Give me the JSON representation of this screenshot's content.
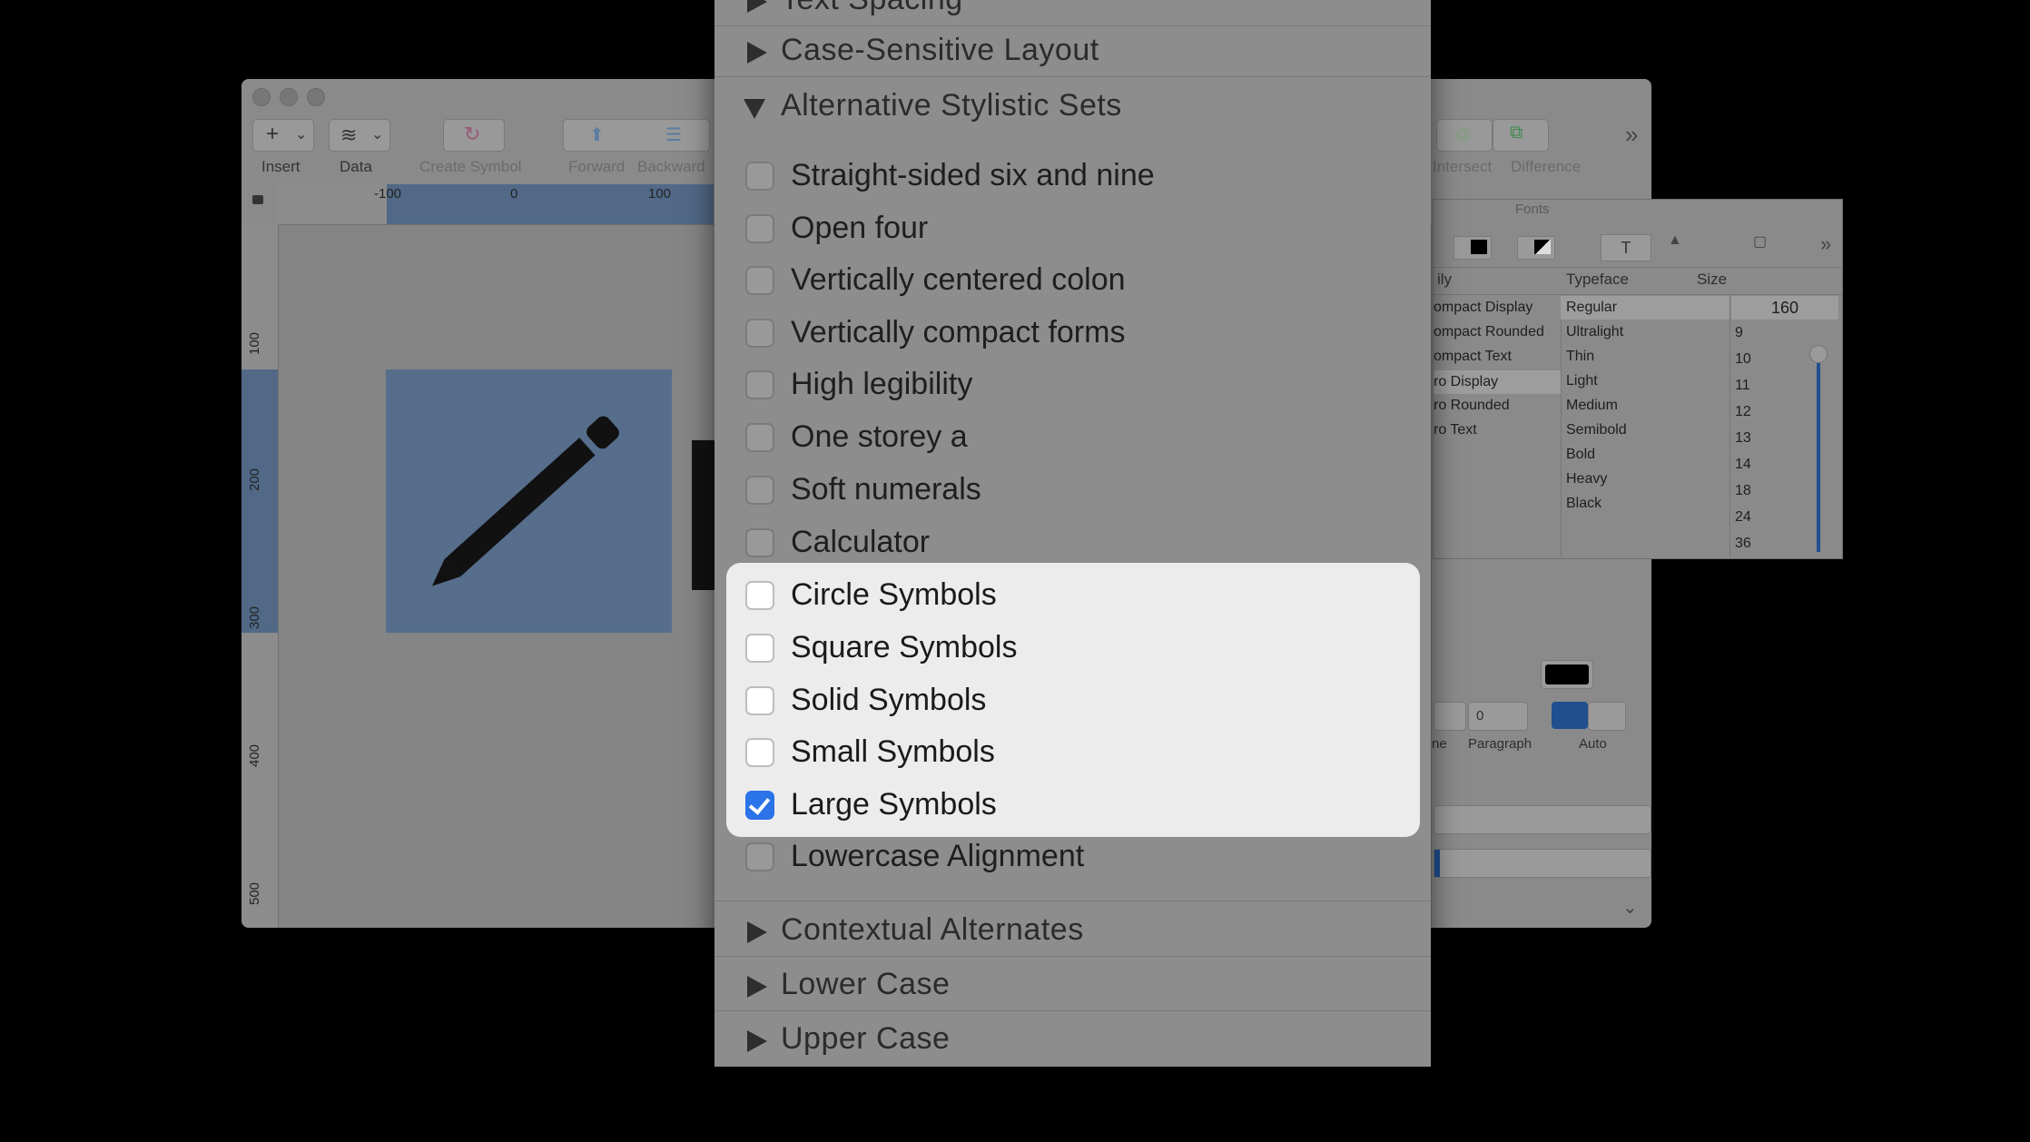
{
  "toolbar": {
    "insert": "Insert",
    "data": "Data",
    "create_symbol": "Create Symbol",
    "forward": "Forward",
    "backward": "Backward",
    "intersect": "Intersect",
    "difference": "Difference"
  },
  "ruler": {
    "top": [
      "-100",
      "0",
      "100"
    ],
    "left": [
      "100",
      "200",
      "300",
      "400",
      "500"
    ]
  },
  "fonts_panel": {
    "title": "Fonts",
    "headers": {
      "family": "ily",
      "typeface": "Typeface",
      "size": "Size"
    },
    "families": [
      "ompact Display",
      "ompact Rounded",
      "ompact Text",
      "ro Display",
      "ro Rounded",
      "ro Text"
    ],
    "typefaces": [
      "Regular",
      "Ultralight",
      "Thin",
      "Light",
      "Medium",
      "Semibold",
      "Bold",
      "Heavy",
      "Black"
    ],
    "size_value": "160",
    "sizes": [
      "9",
      "10",
      "11",
      "12",
      "13",
      "14",
      "18",
      "24",
      "36"
    ]
  },
  "inspector": {
    "spacing_value": "0",
    "line_label": "ne",
    "paragraph_label": "Paragraph",
    "auto_label": "Auto"
  },
  "popup": {
    "top_partial": "Text Spacing",
    "sections_above": [
      "Case-Sensitive Layout"
    ],
    "expanded_section": "Alternative Stylistic Sets",
    "options": [
      {
        "label": "Straight-sided six and nine",
        "checked": false
      },
      {
        "label": "Open four",
        "checked": false
      },
      {
        "label": "Vertically centered colon",
        "checked": false
      },
      {
        "label": "Vertically compact forms",
        "checked": false
      },
      {
        "label": "High legibility",
        "checked": false
      },
      {
        "label": "One storey a",
        "checked": false
      },
      {
        "label": "Soft numerals",
        "checked": false
      },
      {
        "label": "Calculator",
        "checked": false
      }
    ],
    "highlighted_options": [
      {
        "label": "Circle Symbols",
        "checked": false
      },
      {
        "label": "Square Symbols",
        "checked": false
      },
      {
        "label": "Solid Symbols",
        "checked": false
      },
      {
        "label": "Small Symbols",
        "checked": false
      },
      {
        "label": "Large Symbols",
        "checked": true
      }
    ],
    "after_option": {
      "label": "Lowercase Alignment",
      "checked": false
    },
    "sections_below": [
      "Contextual Alternates",
      "Lower Case",
      "Upper Case"
    ]
  },
  "colors": {
    "accent": "#2b73e8",
    "highlight_bg": "#ececec"
  }
}
